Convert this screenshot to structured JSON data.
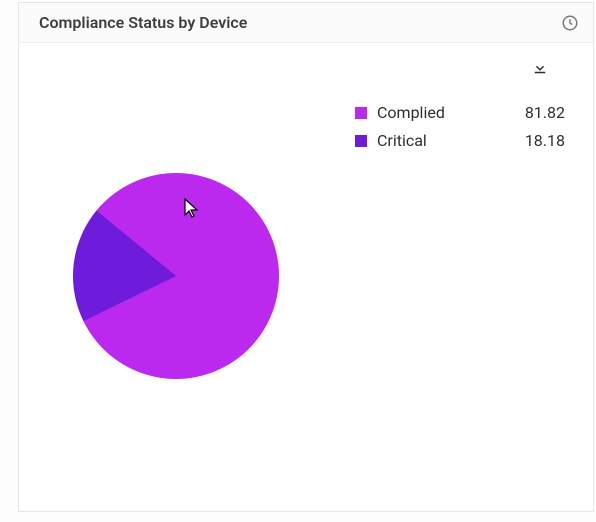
{
  "header": {
    "title": "Compliance Status by Device"
  },
  "legend": {
    "items": [
      {
        "label": "Complied",
        "value": "81.82",
        "color": "#bb29ef"
      },
      {
        "label": "Critical",
        "value": "18.18",
        "color": "#6e1bdc"
      }
    ]
  },
  "colors": {
    "complied": "#bb29ef",
    "critical": "#6e1bdc"
  },
  "chart_data": {
    "type": "pie",
    "title": "Compliance Status by Device",
    "series": [
      {
        "name": "Complied",
        "value": 81.82,
        "color": "#bb29ef"
      },
      {
        "name": "Critical",
        "value": 18.18,
        "color": "#6e1bdc"
      }
    ]
  }
}
